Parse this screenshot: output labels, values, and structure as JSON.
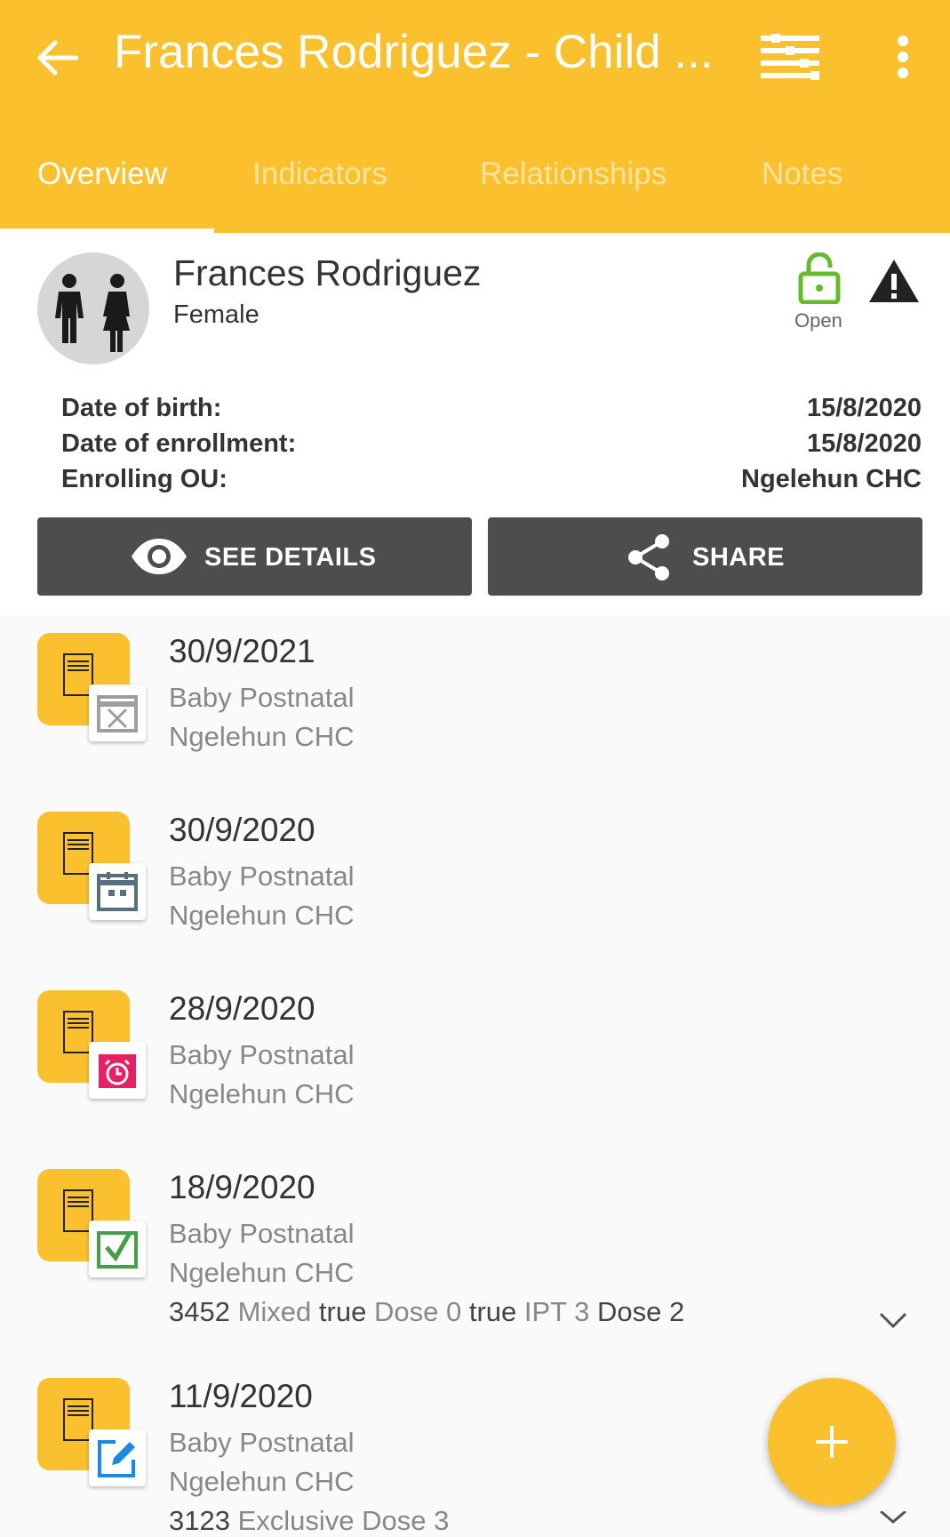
{
  "colors": {
    "primary": "#fbc02d",
    "button": "#4d4d4d",
    "open_status": "#66bb2a"
  },
  "header": {
    "title": "Frances Rodriguez - Child ...",
    "back_icon": "arrow-left-icon",
    "filter_icon": "filter-sliders-icon",
    "menu_icon": "more-vert-icon"
  },
  "tabs": [
    {
      "label": "Overview",
      "active": true
    },
    {
      "label": "Indicators",
      "active": false
    },
    {
      "label": "Relationships",
      "active": false
    },
    {
      "label": "Notes",
      "active": false
    }
  ],
  "profile": {
    "name": "Frances Rodriguez",
    "sex": "Female",
    "status": "Open",
    "status_icon": "lock-open-icon",
    "warning_icon": "warning-icon"
  },
  "details": [
    {
      "label": "Date of birth:",
      "value": "15/8/2020"
    },
    {
      "label": "Date of enrollment:",
      "value": "15/8/2020"
    },
    {
      "label": "Enrolling OU:",
      "value": "Ngelehun CHC"
    }
  ],
  "actions": {
    "see_details": "SEE DETAILS",
    "share": "SHARE"
  },
  "events": [
    {
      "date": "30/9/2021",
      "program_stage": "Baby Postnatal",
      "org_unit": "Ngelehun CHC",
      "status_icon": "calendar-skipped-icon"
    },
    {
      "date": "30/9/2020",
      "program_stage": "Baby Postnatal",
      "org_unit": "Ngelehun CHC",
      "status_icon": "calendar-scheduled-icon"
    },
    {
      "date": "28/9/2020",
      "program_stage": "Baby Postnatal",
      "org_unit": "Ngelehun CHC",
      "status_icon": "calendar-overdue-icon"
    },
    {
      "date": "18/9/2020",
      "program_stage": "Baby Postnatal",
      "org_unit": "Ngelehun CHC",
      "status_icon": "calendar-completed-icon",
      "summary": [
        {
          "text": "3452",
          "strong": true
        },
        {
          "text": "Mixed",
          "strong": false
        },
        {
          "text": "true",
          "strong": true
        },
        {
          "text": "Dose 0",
          "strong": false
        },
        {
          "text": "true",
          "strong": true
        },
        {
          "text": "IPT 3",
          "strong": false
        },
        {
          "text": "Dose 2",
          "strong": true
        }
      ]
    },
    {
      "date": "11/9/2020",
      "program_stage": "Baby Postnatal",
      "org_unit": "Ngelehun CHC",
      "status_icon": "edit-open-icon",
      "summary": [
        {
          "text": "3123",
          "strong": true
        },
        {
          "text": "Exclusive",
          "strong": false
        },
        {
          "text": "Dose 3",
          "strong": false
        }
      ]
    }
  ],
  "fab": {
    "icon": "add-icon"
  }
}
